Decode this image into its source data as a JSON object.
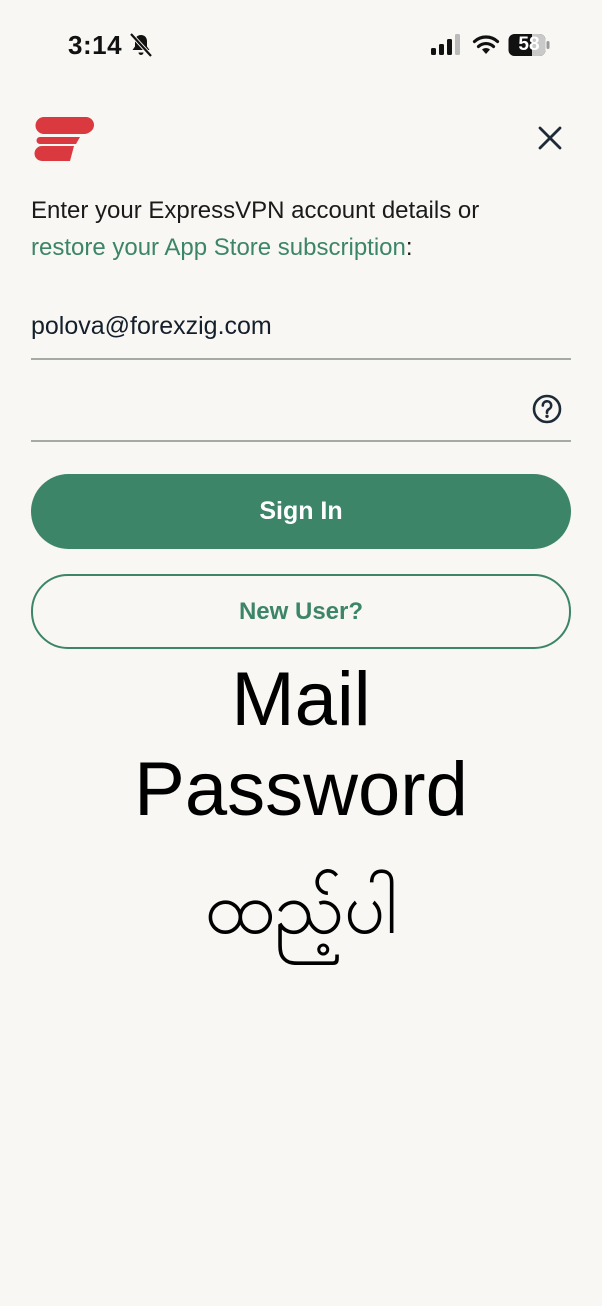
{
  "status_bar": {
    "time": "3:14",
    "battery": "58",
    "icons": [
      "bell-slash-icon",
      "cellular-signal-icon",
      "wifi-icon",
      "battery-icon"
    ]
  },
  "brand": {
    "logo": "expressvpn-logo",
    "accent": "#da3940"
  },
  "colors": {
    "primary": "#3c8569",
    "background": "#f8f7f3"
  },
  "intro": {
    "text_before": "Enter your ExpressVPN account details or ",
    "link": "restore your App Store subscription",
    "text_after": ":"
  },
  "form": {
    "email_value": "polova@forexzig.com",
    "password_value": ""
  },
  "buttons": {
    "sign_in": "Sign In",
    "new_user": "New User?"
  },
  "overlay_text": {
    "line1": "Mail",
    "line2": "Password",
    "line3": "ထည့်ပါ"
  }
}
